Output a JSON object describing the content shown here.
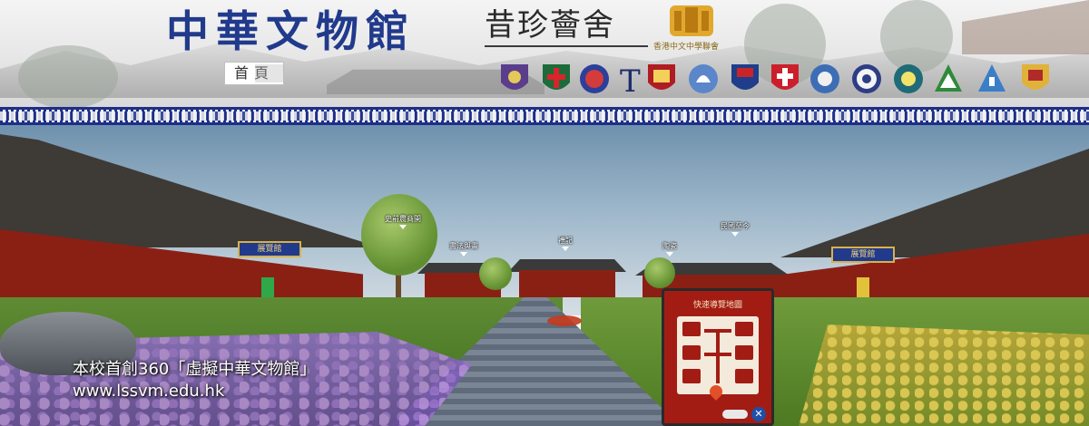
{
  "header": {
    "title": "中華文物館",
    "subtitle": "昔珍薈舍",
    "association_logo_caption": "香港中文中學聯會",
    "home_label": "首頁",
    "school_crests": [
      "school-crest-1",
      "school-crest-2",
      "school-crest-3",
      "school-crest-4",
      "school-crest-5",
      "school-crest-6",
      "school-crest-7",
      "school-crest-8",
      "school-crest-9",
      "school-crest-10",
      "school-crest-11",
      "school-crest-12",
      "school-crest-13",
      "school-crest-14"
    ]
  },
  "colors": {
    "title_blue": "#213a8c",
    "fret_blue": "#1d2f8a",
    "hall_red": "#8a2014",
    "map_red": "#a31c14"
  },
  "scene": {
    "hotspots": {
      "history": "史前農商開",
      "left_hall": "書法與畫",
      "center": "禮記",
      "right_small": "陶瓷",
      "right_hall": "民國至今"
    },
    "left_plaque": "展覽館",
    "right_plaque": "展覽館"
  },
  "map": {
    "title": "快速導覽地圖",
    "close_label": "✕"
  },
  "caption": {
    "line1": "本校首創360「虛擬中華文物館」",
    "line2": "www.lssvm.edu.hk"
  }
}
